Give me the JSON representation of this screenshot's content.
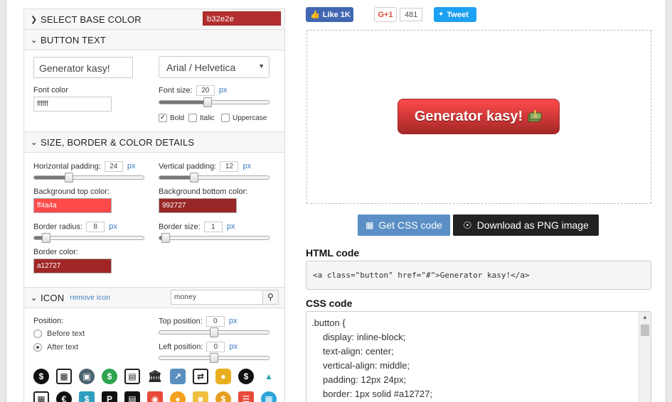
{
  "sections": {
    "base_color": {
      "title": "SELECT BASE COLOR",
      "value": "b32e2e",
      "color": "#b32e2e"
    },
    "button_text": {
      "title": "BUTTON TEXT",
      "text_value": "Generator kasy!",
      "font_value": "Arial / Helvetica",
      "font_color_label": "Font color",
      "font_color_value": "ffffff",
      "font_size_label": "Font size:",
      "font_size_value": "20",
      "unit": "px",
      "font_size_slider": 0.44,
      "bold_label": "Bold",
      "italic_label": "Italic",
      "uppercase_label": "Uppercase"
    },
    "details": {
      "title": "SIZE, BORDER & COLOR DETAILS",
      "hpad_label": "Horizontal padding:",
      "hpad_value": "24",
      "hpad_slider": 0.3,
      "vpad_label": "Vertical padding:",
      "vpad_value": "12",
      "vpad_slider": 0.3,
      "bg_top_label": "Background top color:",
      "bg_top_value": "ff4a4a",
      "bg_top_color": "#ff4a4a",
      "bg_bottom_label": "Background bottom color:",
      "bg_bottom_value": "992727",
      "bg_bottom_color": "#992727",
      "radius_label": "Border radius:",
      "radius_value": "8",
      "radius_slider": 0.08,
      "border_size_label": "Border size:",
      "border_size_value": "1",
      "border_size_slider": 0.02,
      "border_color_label": "Border color:",
      "border_color_value": "a12727",
      "border_color": "#a12727",
      "unit": "px"
    },
    "icon": {
      "title": "ICON",
      "remove_label": "remove icon",
      "search_value": "money",
      "position_label": "Position:",
      "before_label": "Before text",
      "after_label": "After text",
      "top_pos_label": "Top position:",
      "top_pos_value": "0",
      "top_pos_slider": 0.5,
      "left_pos_label": "Left position:",
      "left_pos_value": "0",
      "left_pos_slider": 0.5,
      "unit": "px"
    }
  },
  "social": {
    "facebook_label": "Like 1K",
    "gplus_label": "G+1",
    "gplus_count": "481",
    "tweet_label": "Tweet"
  },
  "preview": {
    "button_text": "Generator kasy!"
  },
  "actions": {
    "css_label": "Get CSS code",
    "png_label": "Download as PNG image"
  },
  "html_code": {
    "title": "HTML code",
    "code": "<a class=\"button\" href=\"#\">Generator kasy!</a>"
  },
  "css_code": {
    "title": "CSS code",
    "lines": [
      ".button {",
      "display: inline-block;",
      "text-align: center;",
      "vertical-align: middle;",
      "padding: 12px 24px;",
      "border: 1px solid #a12727;"
    ]
  }
}
